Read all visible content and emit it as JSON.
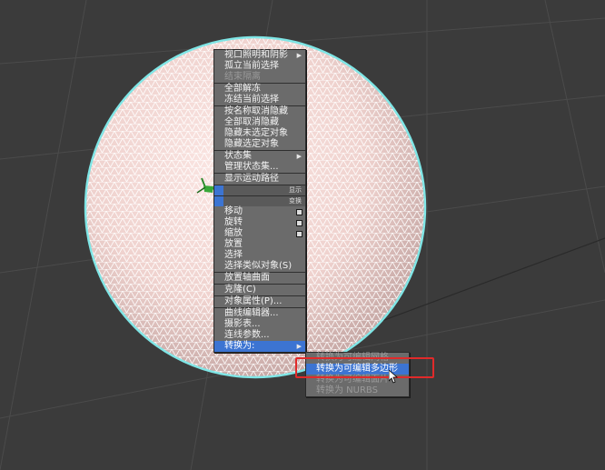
{
  "quad_menu": {
    "items": [
      {
        "label": "视口照明和阴影",
        "submenu": true,
        "sep_after": false
      },
      {
        "label": "孤立当前选择",
        "sep_after": false
      },
      {
        "label": "结束隔离",
        "disabled": true,
        "sep_after": true
      },
      {
        "label": "全部解冻",
        "sep_after": false
      },
      {
        "label": "冻结当前选择",
        "sep_after": true
      },
      {
        "label": "按名称取消隐藏",
        "sep_after": false
      },
      {
        "label": "全部取消隐藏",
        "sep_after": false
      },
      {
        "label": "隐藏未选定对象",
        "sep_after": false
      },
      {
        "label": "隐藏选定对象",
        "sep_after": true
      },
      {
        "label": "状态集",
        "submenu": true,
        "sep_after": false
      },
      {
        "label": "管理状态集...",
        "sep_after": true
      },
      {
        "label": "显示运动路径",
        "sep_after": false
      }
    ],
    "quad_labels": [
      "显示",
      "变换"
    ],
    "transform_items": [
      {
        "label": "移动",
        "box": true
      },
      {
        "label": "旋转",
        "box": true
      },
      {
        "label": "缩放",
        "box": true
      },
      {
        "label": "放置"
      },
      {
        "label": "选择"
      },
      {
        "label": "选择类似对象(S)",
        "sep_after": true
      },
      {
        "label": "放置轴曲面",
        "sep_after": true
      },
      {
        "label": "克隆(C)",
        "sep_after": true
      },
      {
        "label": "对象属性(P)...",
        "sep_after": true
      },
      {
        "label": "曲线编辑器..."
      },
      {
        "label": "摄影表..."
      },
      {
        "label": "连线参数..."
      },
      {
        "label": "转换为:",
        "submenu": true,
        "highlight": true
      }
    ]
  },
  "convert_submenu": {
    "items": [
      {
        "label": "转换为可编辑网格",
        "disabled": true
      },
      {
        "label": "转换为可编辑多边形",
        "highlight": true
      },
      {
        "label": "转换为可编辑面片",
        "disabled": true
      },
      {
        "label": "转换为 NURBS",
        "disabled": true
      }
    ]
  },
  "colors": {
    "viewport_bg": "#3b3b3b",
    "menu_bg": "#6b6b6b",
    "highlight": "#3c74d2",
    "sphere_tint": "#f4d9d6",
    "selection_outline": "#e12a2a",
    "silhouette": "#7fe6e6"
  },
  "icons": {
    "gizmo": "pivot-gizmo-icon",
    "cursor": "mouse-pointer-icon",
    "submenu_arrow": "triangle-right-icon"
  }
}
